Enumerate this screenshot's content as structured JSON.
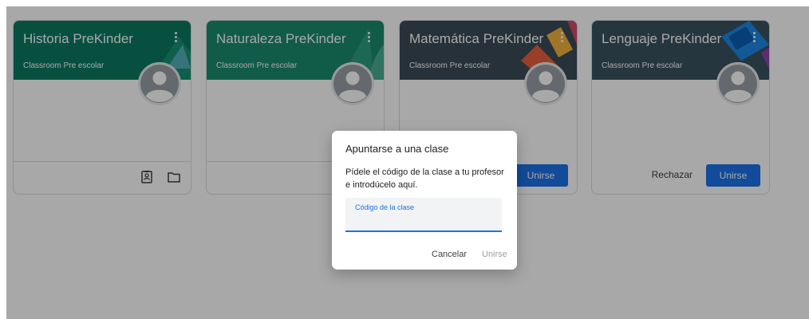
{
  "classes": [
    {
      "title": "Historia PreKinder",
      "subtitle": "Classroom Pre escolar",
      "color": "#0c7a60"
    },
    {
      "title": "Naturaleza PreKinder",
      "subtitle": "Classroom Pre escolar",
      "color": "#1a8a70"
    },
    {
      "title": "Matemática PreKinder",
      "subtitle": "Classroom Pre escolar",
      "color": "#3b4b57",
      "join_label": "Unirse"
    },
    {
      "title": "Lenguaje PreKinder",
      "subtitle": "Classroom Pre escolar",
      "color": "#3b5260",
      "reject_label": "Rechazar",
      "join_label": "Unirse"
    }
  ],
  "card_icons": [
    "assignment-icon",
    "folder-icon"
  ],
  "dialog": {
    "title": "Apuntarse a una clase",
    "text": "Pídele el código de la clase a tu profesor e introdúcelo aquí.",
    "field_label": "Código de la clase",
    "field_value": "",
    "cancel_label": "Cancelar",
    "join_label": "Unirse"
  },
  "colors": {
    "accent": "#1a73e8",
    "overlay": "rgba(0,0,0,0.34)"
  }
}
